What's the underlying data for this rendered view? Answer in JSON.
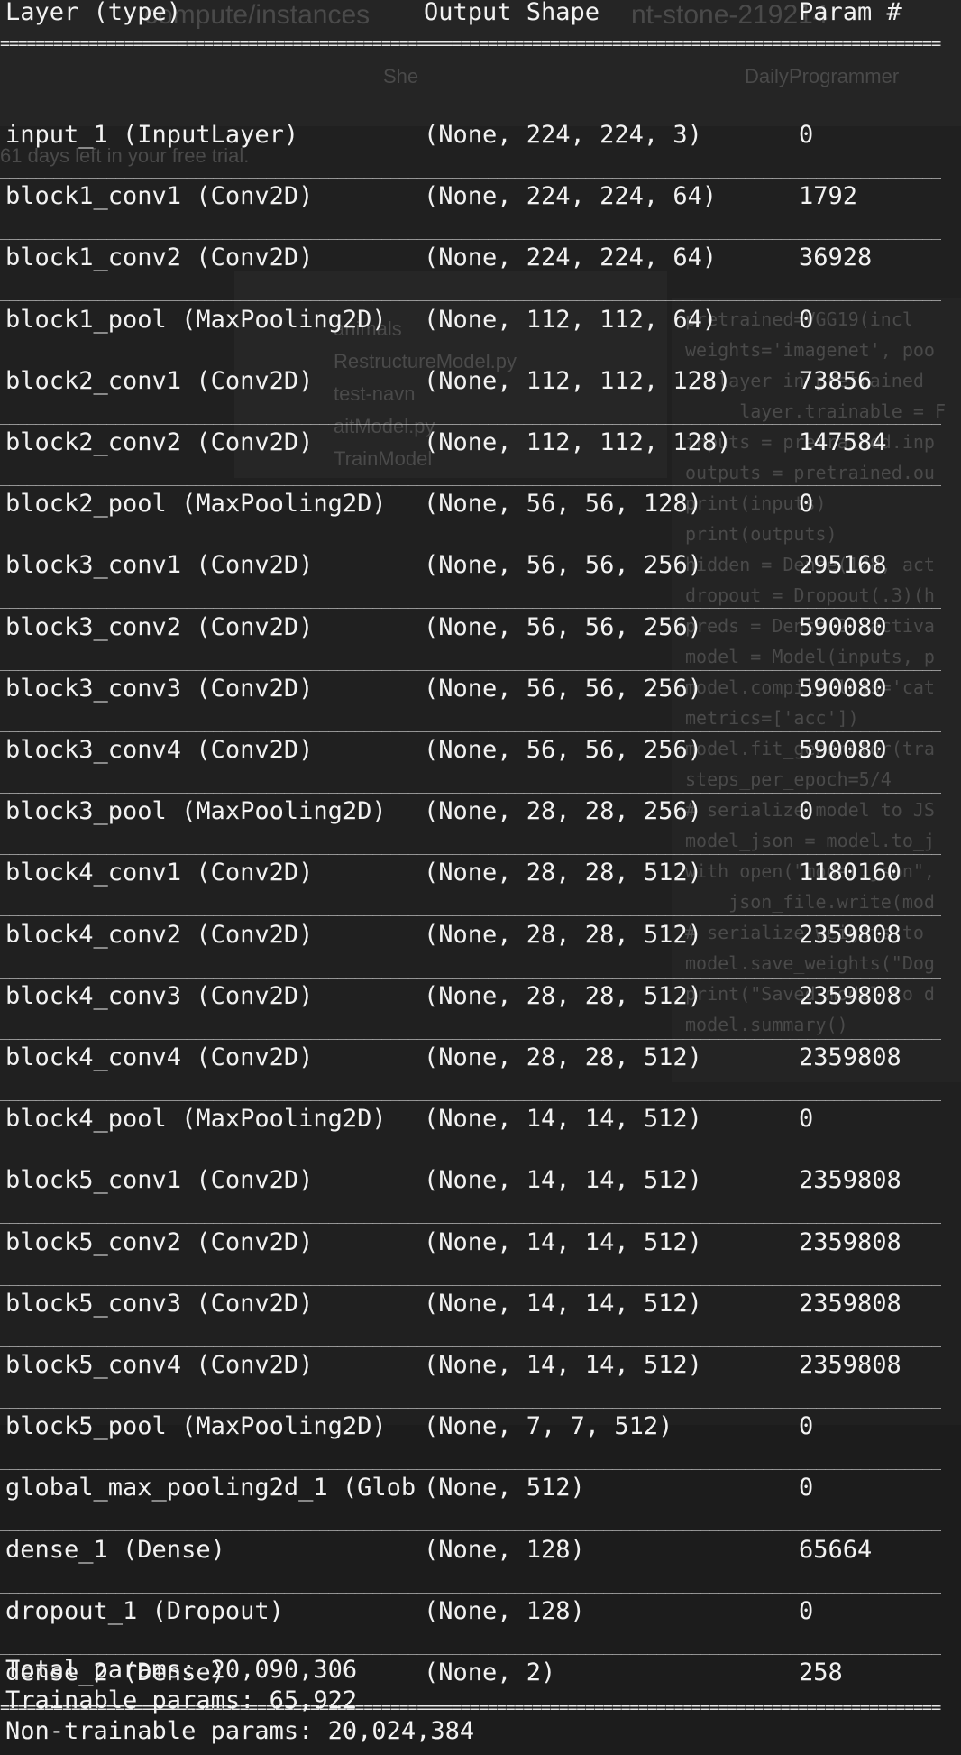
{
  "background_window": {
    "url_fragment": "compute/instances",
    "instance_fragment": "nt-stone-219214",
    "tab_left": "She",
    "tab_right": "DailyProgrammer",
    "trial_text": "61 days left in your free trial.",
    "tree_items": [
      "animals",
      "RestructureModel.py",
      "test-navn",
      "aitModel.py",
      "TrainModel"
    ],
    "code_lines": [
      "pretrained=VGG19(incl",
      "weights='imagenet', poo",
      "   layer in pretrained",
      "     layer.trainable = F",
      "inputs = pretrained.inp",
      "outputs = pretrained.ou",
      "print(inputs)",
      "print(outputs)",
      "hidden = Dense(128, act",
      "dropout = Dropout(.3)(h",
      "preds = Dense(2, activa",
      "model = Model(inputs, p",
      "model.compile(loss='cat",
      "metrics=['acc'])",
      "model.fit_generator(tra",
      "steps_per_epoch=5/4",
      "# serialize model to JS",
      "model_json = model.to_j",
      "with open(\"model.json\",",
      "    json_file.write(mod",
      "# serialize weights to",
      "model.save_weights(\"Dog",
      "print(\"Saved model to d",
      "model.summary()"
    ]
  },
  "summary": {
    "headers": {
      "layer": "Layer (type)",
      "shape": "Output Shape",
      "params": "Param #"
    },
    "rows": [
      {
        "layer": "input_1 (InputLayer)",
        "shape": "(None, 224, 224, 3)",
        "params": "0"
      },
      {
        "layer": "block1_conv1 (Conv2D)",
        "shape": "(None, 224, 224, 64)",
        "params": "1792"
      },
      {
        "layer": "block1_conv2 (Conv2D)",
        "shape": "(None, 224, 224, 64)",
        "params": "36928"
      },
      {
        "layer": "block1_pool (MaxPooling2D)",
        "shape": "(None, 112, 112, 64)",
        "params": "0"
      },
      {
        "layer": "block2_conv1 (Conv2D)",
        "shape": "(None, 112, 112, 128)",
        "params": "73856"
      },
      {
        "layer": "block2_conv2 (Conv2D)",
        "shape": "(None, 112, 112, 128)",
        "params": "147584"
      },
      {
        "layer": "block2_pool (MaxPooling2D)",
        "shape": "(None, 56, 56, 128)",
        "params": "0"
      },
      {
        "layer": "block3_conv1 (Conv2D)",
        "shape": "(None, 56, 56, 256)",
        "params": "295168"
      },
      {
        "layer": "block3_conv2 (Conv2D)",
        "shape": "(None, 56, 56, 256)",
        "params": "590080"
      },
      {
        "layer": "block3_conv3 (Conv2D)",
        "shape": "(None, 56, 56, 256)",
        "params": "590080"
      },
      {
        "layer": "block3_conv4 (Conv2D)",
        "shape": "(None, 56, 56, 256)",
        "params": "590080"
      },
      {
        "layer": "block3_pool (MaxPooling2D)",
        "shape": "(None, 28, 28, 256)",
        "params": "0"
      },
      {
        "layer": "block4_conv1 (Conv2D)",
        "shape": "(None, 28, 28, 512)",
        "params": "1180160"
      },
      {
        "layer": "block4_conv2 (Conv2D)",
        "shape": "(None, 28, 28, 512)",
        "params": "2359808"
      },
      {
        "layer": "block4_conv3 (Conv2D)",
        "shape": "(None, 28, 28, 512)",
        "params": "2359808"
      },
      {
        "layer": "block4_conv4 (Conv2D)",
        "shape": "(None, 28, 28, 512)",
        "params": "2359808"
      },
      {
        "layer": "block4_pool (MaxPooling2D)",
        "shape": "(None, 14, 14, 512)",
        "params": "0"
      },
      {
        "layer": "block5_conv1 (Conv2D)",
        "shape": "(None, 14, 14, 512)",
        "params": "2359808"
      },
      {
        "layer": "block5_conv2 (Conv2D)",
        "shape": "(None, 14, 14, 512)",
        "params": "2359808"
      },
      {
        "layer": "block5_conv3 (Conv2D)",
        "shape": "(None, 14, 14, 512)",
        "params": "2359808"
      },
      {
        "layer": "block5_conv4 (Conv2D)",
        "shape": "(None, 14, 14, 512)",
        "params": "2359808"
      },
      {
        "layer": "block5_pool (MaxPooling2D)",
        "shape": "(None, 7, 7, 512)",
        "params": "0"
      },
      {
        "layer": "global_max_pooling2d_1 (Glob",
        "shape": "(None, 512)",
        "params": "0"
      },
      {
        "layer": "dense_1 (Dense)",
        "shape": "(None, 128)",
        "params": "65664"
      },
      {
        "layer": "dropout_1 (Dropout)",
        "shape": "(None, 128)",
        "params": "0"
      },
      {
        "layer": "dense_2 (Dense)",
        "shape": "(None, 2)",
        "params": "258"
      }
    ],
    "totals": {
      "total": "Total params: 20,090,306",
      "trainable": "Trainable params: 65,922",
      "non_trainable": "Non-trainable params: 20,024,384"
    }
  },
  "colors": {
    "terminal_bg": "#1c1c1c",
    "text": "#f2f2f2",
    "ghost_text": "#4a4a4a"
  }
}
